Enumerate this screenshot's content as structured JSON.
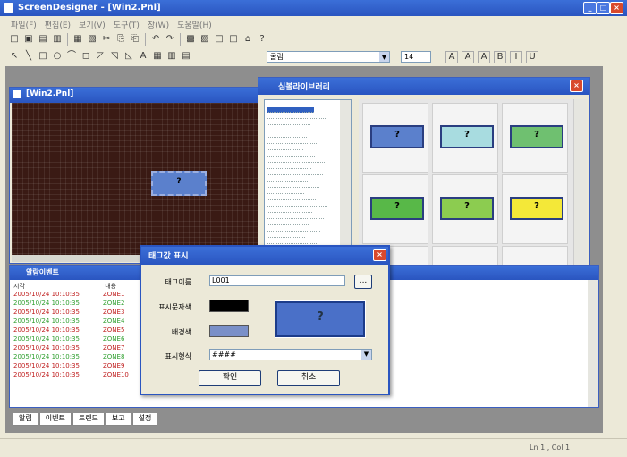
{
  "app": {
    "title": "ScreenDesigner - [Win2.Pnl]"
  },
  "menu": [
    "파일(F)",
    "편집(E)",
    "보기(V)",
    "도구(T)",
    "창(W)",
    "도움말(H)"
  ],
  "toolbar1": [
    "□",
    "▣",
    "▤",
    "▥",
    "▦",
    "▧",
    "✂",
    "⎘",
    "⎗",
    "↶",
    "↷",
    "▩",
    "▨",
    "□",
    "□",
    "⌂",
    "?"
  ],
  "toolbar2": [
    "↖",
    "╲",
    "□",
    "○",
    "⌒",
    "◻",
    "◸",
    "◹",
    "◺",
    "A",
    "▦",
    "▥",
    "▤"
  ],
  "font_select": {
    "value": "굴림",
    "size": "14"
  },
  "format_buttons": [
    "A",
    "A",
    "A",
    "B",
    "I",
    "U"
  ],
  "doc_window": {
    "title": "[Win2.Pnl]"
  },
  "palette": {
    "title": "심볼라이브러리",
    "symbols": [
      {
        "label": "?",
        "color": "#5b80cc"
      },
      {
        "label": "?",
        "color": "#a8dce0"
      },
      {
        "label": "?",
        "color": "#6fc070"
      },
      {
        "label": "?",
        "color": "#58b848"
      },
      {
        "label": "?",
        "color": "#8ccc50"
      },
      {
        "label": "?",
        "color": "#f4e838"
      },
      {
        "label": "",
        "color": "#e89830"
      }
    ]
  },
  "canvas_symbol": {
    "label": "?",
    "color": "#5b80cc"
  },
  "log_window": {
    "title": "알람이벤트",
    "header": [
      "시각",
      "내용"
    ],
    "rows": [
      {
        "time": "2005/10/24 10:10:35",
        "text": "ZONE1",
        "color": "#c02020"
      },
      {
        "time": "2005/10/24 10:10:35",
        "text": "ZONE2",
        "color": "#30a030"
      },
      {
        "time": "2005/10/24 10:10:35",
        "text": "ZONE3",
        "color": "#c02020"
      },
      {
        "time": "2005/10/24 10:10:35",
        "text": "ZONE4",
        "color": "#30a030"
      },
      {
        "time": "2005/10/24 10:10:35",
        "text": "ZONE5",
        "color": "#c02020"
      },
      {
        "time": "2005/10/24 10:10:35",
        "text": "ZONE6",
        "color": "#30a030"
      },
      {
        "time": "2005/10/24 10:10:35",
        "text": "ZONE7",
        "color": "#c02020"
      },
      {
        "time": "2005/10/24 10:10:35",
        "text": "ZONE8",
        "color": "#30a030"
      },
      {
        "time": "2005/10/24 10:10:35",
        "text": "ZONE9",
        "color": "#c02020"
      },
      {
        "time": "2005/10/24 10:10:35",
        "text": "ZONE10",
        "color": "#c02020"
      }
    ]
  },
  "bottom_tabs": [
    "알림",
    "이벤트",
    "트렌드",
    "보고",
    "설정"
  ],
  "dialog": {
    "title": "태그값 표시",
    "rows": [
      {
        "label": "태그이름",
        "value": "L001"
      },
      {
        "label": "표시문자색",
        "value": ""
      },
      {
        "label": "배경색",
        "value": ""
      },
      {
        "label": "표시형식",
        "value": "####"
      }
    ],
    "browse": "...",
    "preview_label": "?",
    "ok": "확인",
    "cancel": "취소"
  },
  "status": {
    "right": "Ln 1 , Col 1"
  },
  "colors": {
    "text_color": "#000000",
    "bg_color": "#7a90c8",
    "preview": "#4a70c8"
  }
}
